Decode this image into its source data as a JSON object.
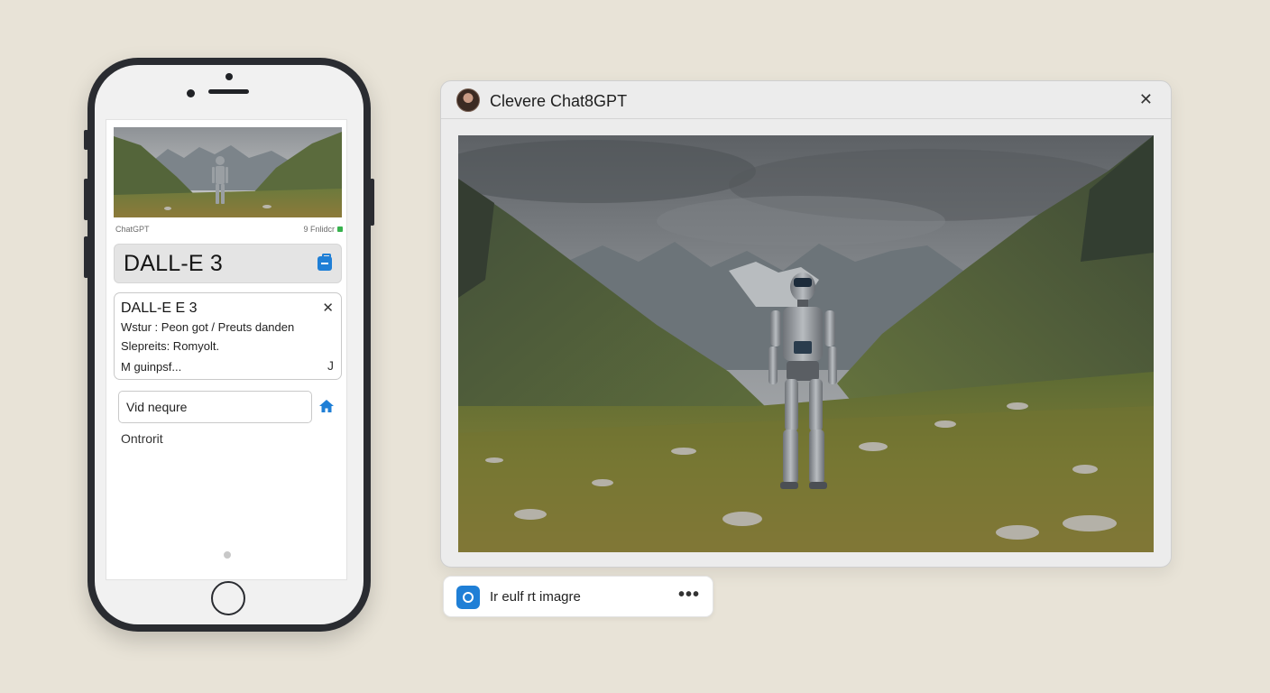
{
  "phone": {
    "meta_left": "ChatGPT",
    "meta_right": "9 Fnlidcr",
    "title": "DALL-E 3",
    "detail": {
      "heading": "DALL-E E 3",
      "close_glyph": "✕",
      "line1": "Wstur : Peon got / Preuts danden",
      "line2": "Slepreits: Romyolt.",
      "line3": "M guinpsf...",
      "corner_glyph": "J"
    },
    "input_value": "Vid nequre",
    "link_text": "Ontrorit"
  },
  "window": {
    "title": "Clevere Chat8GPT",
    "close_glyph": "✕"
  },
  "pill": {
    "text": "Ir eulf rt imagre",
    "more_glyph": "•••"
  },
  "colors": {
    "background": "#e8e3d7",
    "phone_frame": "#2a2c31",
    "accent_blue": "#1f7fd6",
    "window_bg": "#ececec"
  },
  "icons": {
    "title_card_icon": "clipboard-icon",
    "input_action_icon": "home-icon",
    "pill_icon": "camera-icon",
    "window_close_icon": "close-icon",
    "pill_more_icon": "more-horizontal-icon"
  }
}
